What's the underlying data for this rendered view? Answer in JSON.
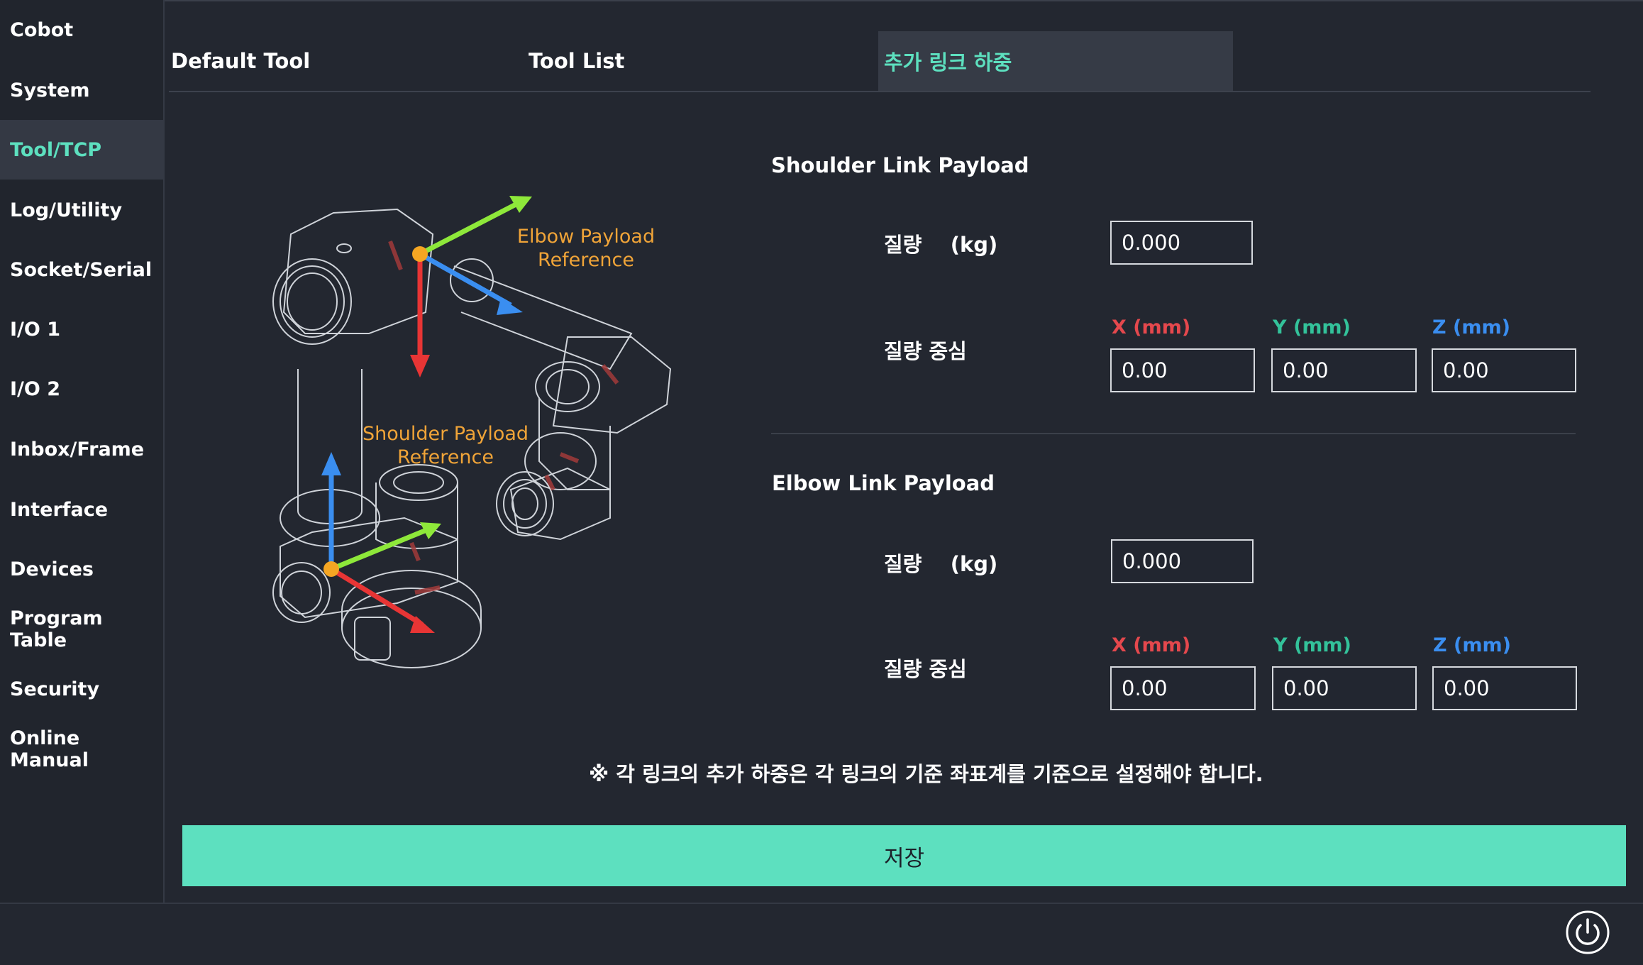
{
  "sidebar": {
    "items": [
      {
        "label": "Cobot"
      },
      {
        "label": "System"
      },
      {
        "label": "Tool/TCP"
      },
      {
        "label": "Log/Utility"
      },
      {
        "label": "Socket/Serial"
      },
      {
        "label": "I/O 1"
      },
      {
        "label": "I/O 2"
      },
      {
        "label": "Inbox/Frame"
      },
      {
        "label": "Interface"
      },
      {
        "label": "Devices"
      },
      {
        "label": "Program Table"
      },
      {
        "label": "Security"
      },
      {
        "label": "Online Manual"
      }
    ],
    "active": "Tool/TCP"
  },
  "tabs": [
    {
      "label": "Default Tool"
    },
    {
      "label": "Tool List"
    },
    {
      "label": "추가 링크 하중"
    }
  ],
  "active_tab": "추가 링크 하중",
  "illustration": {
    "elbow_label_line1": "Elbow Payload",
    "elbow_label_line2": "Reference",
    "shoulder_label_line1": "Shoulder Payload",
    "shoulder_label_line2": "Reference"
  },
  "shoulder": {
    "title": "Shoulder Link Payload",
    "mass_label": "질량    (kg)",
    "mass_value": "0.000",
    "center_label": "질량 중심",
    "x_label": "X (mm)",
    "y_label": "Y (mm)",
    "z_label": "Z (mm)",
    "x_value": "0.00",
    "y_value": "0.00",
    "z_value": "0.00"
  },
  "elbow": {
    "title": "Elbow Link Payload",
    "mass_label": "질량    (kg)",
    "mass_value": "0.000",
    "center_label": "질량 중심",
    "x_label": "X (mm)",
    "y_label": "Y (mm)",
    "z_label": "Z (mm)",
    "x_value": "0.00",
    "y_value": "0.00",
    "z_value": "0.00"
  },
  "note": "※ 각 링크의 추가 하중은 각 링크의 기준 좌표계를 기준으로 설정해야 합니다.",
  "save_label": "저장",
  "colors": {
    "accent": "#5de0bf",
    "x_axis": "#e5484d",
    "y_axis": "#33c29a",
    "z_axis": "#3a8ef0",
    "label_orange": "#f0a438"
  },
  "icons": {
    "power": "power-icon"
  }
}
